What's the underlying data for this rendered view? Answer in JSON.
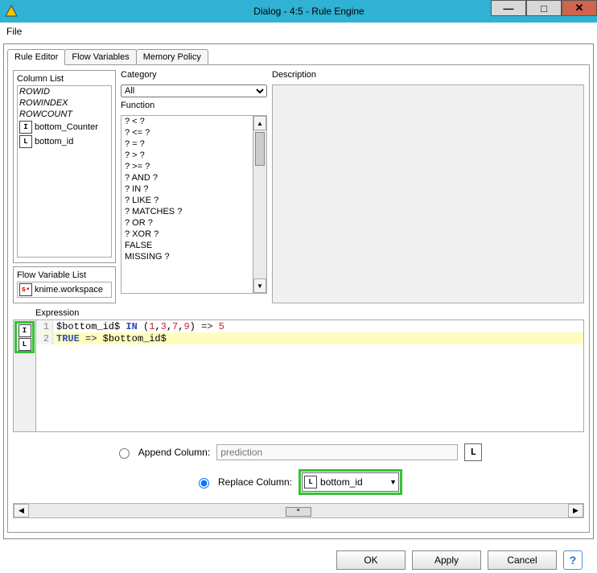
{
  "window": {
    "title": "Dialog - 4:5 - Rule Engine"
  },
  "menu": {
    "file": "File"
  },
  "tabs": [
    {
      "label": "Rule Editor",
      "active": true
    },
    {
      "label": "Flow Variables",
      "active": false
    },
    {
      "label": "Memory Policy",
      "active": false
    }
  ],
  "columnList": {
    "label": "Column List",
    "items": [
      {
        "name": "ROWID",
        "italic": true
      },
      {
        "name": "ROWINDEX",
        "italic": true
      },
      {
        "name": "ROWCOUNT",
        "italic": true
      },
      {
        "name": "bottom_Counter",
        "type": "I"
      },
      {
        "name": "bottom_id",
        "type": "L"
      }
    ]
  },
  "flowVarList": {
    "label": "Flow Variable List",
    "items": [
      {
        "name": "knime.workspace",
        "type": "s"
      }
    ]
  },
  "category": {
    "label": "Category",
    "selected": "All"
  },
  "functions": {
    "label": "Function",
    "items": [
      "? < ?",
      "? <= ?",
      "? = ?",
      "? > ?",
      "? >= ?",
      "? AND ?",
      "? IN ?",
      "? LIKE ?",
      "? MATCHES ?",
      "? OR ?",
      "? XOR ?",
      "FALSE",
      "MISSING ?"
    ]
  },
  "description": {
    "label": "Description"
  },
  "expression": {
    "label": "Expression",
    "lines": [
      {
        "n": 1,
        "gutterType": "I",
        "tokens": [
          {
            "t": "$bottom_id$ ",
            "c": ""
          },
          {
            "t": "IN",
            "c": "kw"
          },
          {
            "t": " (",
            "c": ""
          },
          {
            "t": "1",
            "c": "num"
          },
          {
            "t": ",",
            "c": ""
          },
          {
            "t": "3",
            "c": "num"
          },
          {
            "t": ",",
            "c": ""
          },
          {
            "t": "7",
            "c": "num"
          },
          {
            "t": ",",
            "c": ""
          },
          {
            "t": "9",
            "c": "num"
          },
          {
            "t": ") ",
            "c": ""
          },
          {
            "t": "=>",
            "c": "arrow"
          },
          {
            "t": " ",
            "c": ""
          },
          {
            "t": "5",
            "c": "num"
          }
        ]
      },
      {
        "n": 2,
        "gutterType": "L",
        "tokens": [
          {
            "t": "TRUE",
            "c": "kw"
          },
          {
            "t": " ",
            "c": ""
          },
          {
            "t": "=>",
            "c": "arrow"
          },
          {
            "t": " $bottom_id$",
            "c": ""
          }
        ],
        "highlight": true
      }
    ]
  },
  "output": {
    "appendLabel": "Append Column:",
    "appendPlaceholder": "prediction",
    "appendTypeBadge": "L",
    "replaceLabel": "Replace Column:",
    "replaceSelected": "bottom_id",
    "replaceType": "L",
    "selected": "replace"
  },
  "buttons": {
    "ok": "OK",
    "apply": "Apply",
    "cancel": "Cancel"
  }
}
